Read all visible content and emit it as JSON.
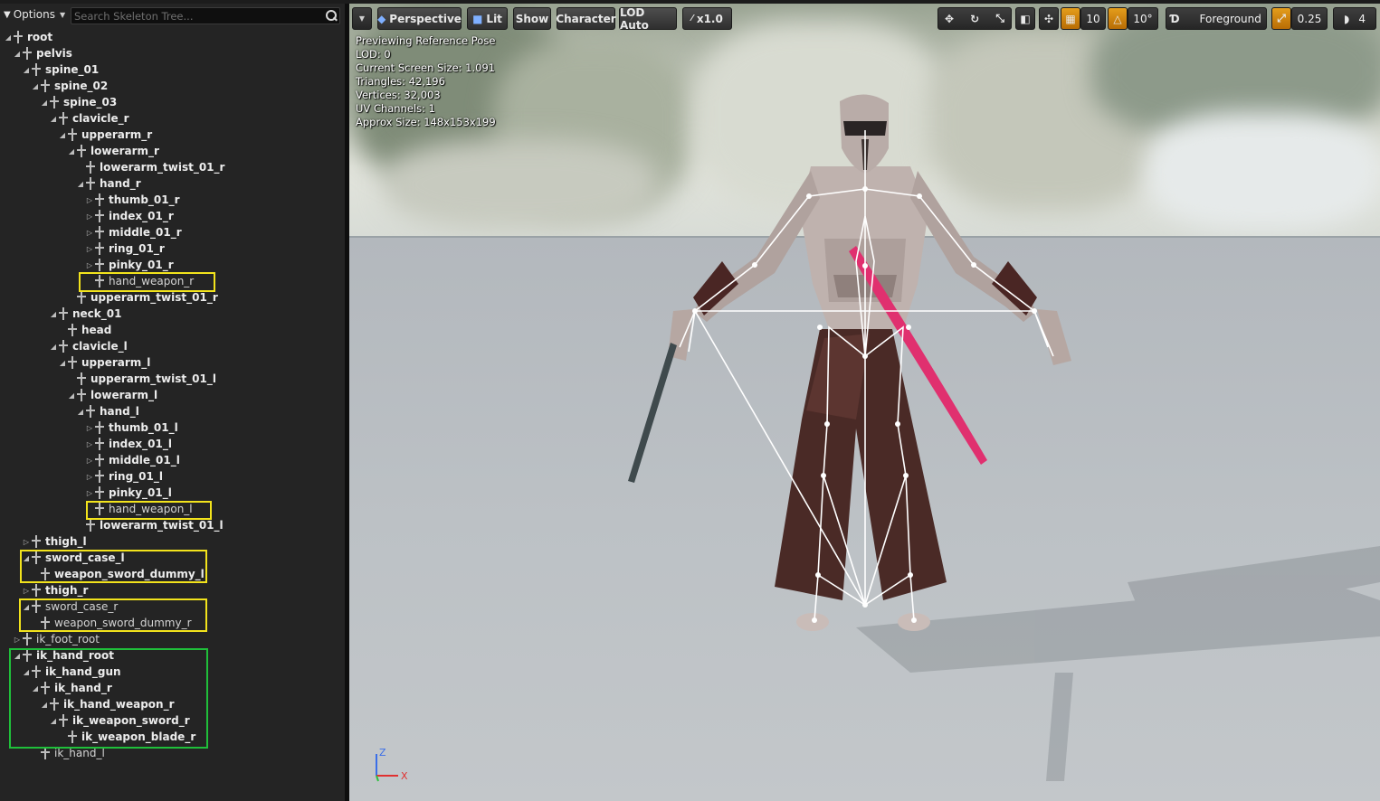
{
  "tree_toolbar": {
    "options_label": "Options",
    "search_placeholder": "Search Skeleton Tree..."
  },
  "bones": [
    {
      "label": "root",
      "depth": 0,
      "arrow": "expanded",
      "style": "bold"
    },
    {
      "label": "pelvis",
      "depth": 1,
      "arrow": "expanded",
      "style": "bold"
    },
    {
      "label": "spine_01",
      "depth": 2,
      "arrow": "expanded",
      "style": "bold"
    },
    {
      "label": "spine_02",
      "depth": 3,
      "arrow": "expanded",
      "style": "bold"
    },
    {
      "label": "spine_03",
      "depth": 4,
      "arrow": "expanded",
      "style": "bold"
    },
    {
      "label": "clavicle_r",
      "depth": 5,
      "arrow": "expanded",
      "style": "bold"
    },
    {
      "label": "upperarm_r",
      "depth": 6,
      "arrow": "expanded",
      "style": "bold"
    },
    {
      "label": "lowerarm_r",
      "depth": 7,
      "arrow": "expanded",
      "style": "bold"
    },
    {
      "label": "lowerarm_twist_01_r",
      "depth": 8,
      "arrow": "none",
      "style": "bold"
    },
    {
      "label": "hand_r",
      "depth": 8,
      "arrow": "expanded",
      "style": "bold"
    },
    {
      "label": "thumb_01_r",
      "depth": 9,
      "arrow": "collapsed",
      "style": "bold"
    },
    {
      "label": "index_01_r",
      "depth": 9,
      "arrow": "collapsed",
      "style": "bold"
    },
    {
      "label": "middle_01_r",
      "depth": 9,
      "arrow": "collapsed",
      "style": "bold"
    },
    {
      "label": "ring_01_r",
      "depth": 9,
      "arrow": "collapsed",
      "style": "bold"
    },
    {
      "label": "pinky_01_r",
      "depth": 9,
      "arrow": "collapsed",
      "style": "bold"
    },
    {
      "label": "hand_weapon_r",
      "depth": 9,
      "arrow": "none",
      "style": "normal"
    },
    {
      "label": "upperarm_twist_01_r",
      "depth": 7,
      "arrow": "none",
      "style": "bold"
    },
    {
      "label": "neck_01",
      "depth": 5,
      "arrow": "expanded",
      "style": "bold"
    },
    {
      "label": "head",
      "depth": 6,
      "arrow": "none",
      "style": "bold"
    },
    {
      "label": "clavicle_l",
      "depth": 5,
      "arrow": "expanded",
      "style": "bold"
    },
    {
      "label": "upperarm_l",
      "depth": 6,
      "arrow": "expanded",
      "style": "bold"
    },
    {
      "label": "upperarm_twist_01_l",
      "depth": 7,
      "arrow": "none",
      "style": "bold"
    },
    {
      "label": "lowerarm_l",
      "depth": 7,
      "arrow": "expanded",
      "style": "bold"
    },
    {
      "label": "hand_l",
      "depth": 8,
      "arrow": "expanded",
      "style": "bold"
    },
    {
      "label": "thumb_01_l",
      "depth": 9,
      "arrow": "collapsed",
      "style": "bold"
    },
    {
      "label": "index_01_l",
      "depth": 9,
      "arrow": "collapsed",
      "style": "bold"
    },
    {
      "label": "middle_01_l",
      "depth": 9,
      "arrow": "collapsed",
      "style": "bold"
    },
    {
      "label": "ring_01_l",
      "depth": 9,
      "arrow": "collapsed",
      "style": "bold"
    },
    {
      "label": "pinky_01_l",
      "depth": 9,
      "arrow": "collapsed",
      "style": "bold"
    },
    {
      "label": "hand_weapon_l",
      "depth": 9,
      "arrow": "none",
      "style": "normal"
    },
    {
      "label": "lowerarm_twist_01_l",
      "depth": 8,
      "arrow": "none",
      "style": "bold"
    },
    {
      "label": "thigh_l",
      "depth": 2,
      "arrow": "collapsed",
      "style": "bold"
    },
    {
      "label": "sword_case_l",
      "depth": 2,
      "arrow": "expanded",
      "style": "bold"
    },
    {
      "label": "weapon_sword_dummy_l",
      "depth": 3,
      "arrow": "none",
      "style": "bold"
    },
    {
      "label": "thigh_r",
      "depth": 2,
      "arrow": "collapsed",
      "style": "bold"
    },
    {
      "label": "sword_case_r",
      "depth": 2,
      "arrow": "expanded",
      "style": "normal"
    },
    {
      "label": "weapon_sword_dummy_r",
      "depth": 3,
      "arrow": "none",
      "style": "normal"
    },
    {
      "label": "ik_foot_root",
      "depth": 1,
      "arrow": "collapsed",
      "style": "normal"
    },
    {
      "label": "ik_hand_root",
      "depth": 1,
      "arrow": "expanded",
      "style": "bold"
    },
    {
      "label": "ik_hand_gun",
      "depth": 2,
      "arrow": "expanded",
      "style": "bold"
    },
    {
      "label": "ik_hand_r",
      "depth": 3,
      "arrow": "expanded",
      "style": "bold"
    },
    {
      "label": "ik_hand_weapon_r",
      "depth": 4,
      "arrow": "expanded",
      "style": "bold"
    },
    {
      "label": "ik_weapon_sword_r",
      "depth": 5,
      "arrow": "expanded",
      "style": "bold"
    },
    {
      "label": "ik_weapon_blade_r",
      "depth": 6,
      "arrow": "none",
      "style": "bold"
    },
    {
      "label": "ik_hand_l",
      "depth": 3,
      "arrow": "none",
      "style": "normal"
    }
  ],
  "viewport_toolbar": {
    "perspective": "Perspective",
    "lit": "Lit",
    "show": "Show",
    "character": "Character",
    "lod": "LOD Auto",
    "speed": "x1.0",
    "grid_snap": "10",
    "rotation_snap": "10°",
    "layer": "Foreground",
    "scale_snap": "0.25",
    "camera_speed": "4"
  },
  "stats": [
    "Previewing Reference Pose",
    "LOD: 0",
    "Current Screen Size: 1.091",
    "Triangles: 42,196",
    "Vertices: 32,003",
    "UV Channels: 1",
    "Approx Size: 148x153x199"
  ],
  "axis": {
    "z": "Z",
    "x": "X"
  },
  "colors": {
    "highlight_yellow": "#f2e31c",
    "highlight_green": "#1fbf3a",
    "skeleton": "#ffffff",
    "weapon_bone": "#e0306f",
    "accent_orange": "#e49d1c"
  }
}
